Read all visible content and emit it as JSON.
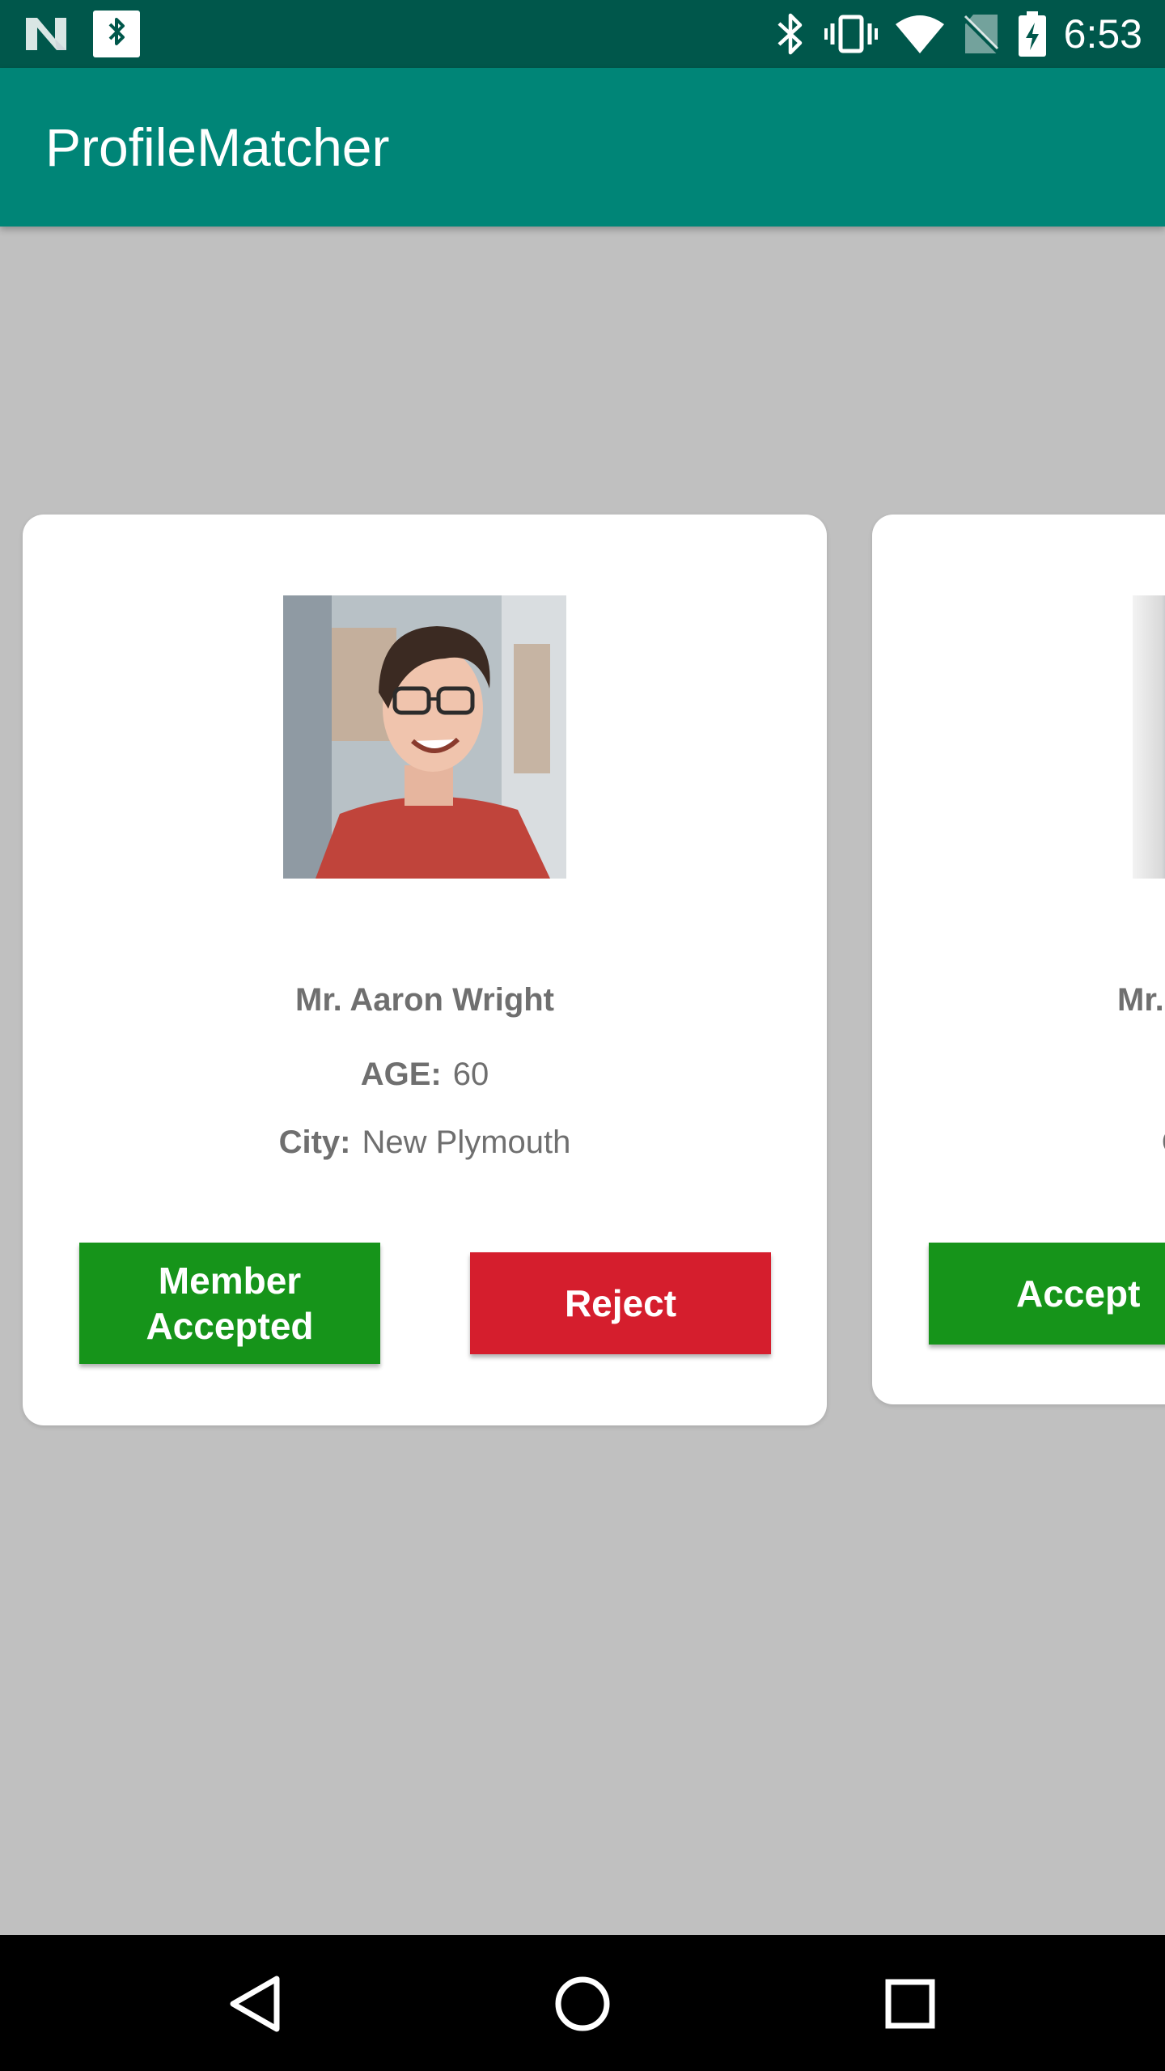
{
  "status_bar": {
    "time": "6:53",
    "icons": [
      "n-logo-icon",
      "bluetooth-box-icon",
      "bluetooth-icon",
      "vibrate-icon",
      "wifi-icon",
      "no-sim-icon",
      "battery-charging-icon"
    ]
  },
  "app_bar": {
    "title": "ProfileMatcher"
  },
  "cards": [
    {
      "name": "Mr. Aaron Wright",
      "age_label": "AGE:",
      "age_value": "60",
      "city_label": "City:",
      "city_value": "New Plymouth",
      "primary_button": "Member Accepted",
      "secondary_button": "Reject"
    },
    {
      "name_partial": "Mr.",
      "city_partial": "C",
      "primary_button": "Accept"
    }
  ],
  "colors": {
    "status_bar": "#00574b",
    "app_bar": "#008577",
    "background": "#c0c0c0",
    "accept_green": "#16941a",
    "reject_red": "#d51e2d"
  },
  "nav_bar": {
    "icons": [
      "back-icon",
      "home-icon",
      "recents-icon"
    ]
  }
}
